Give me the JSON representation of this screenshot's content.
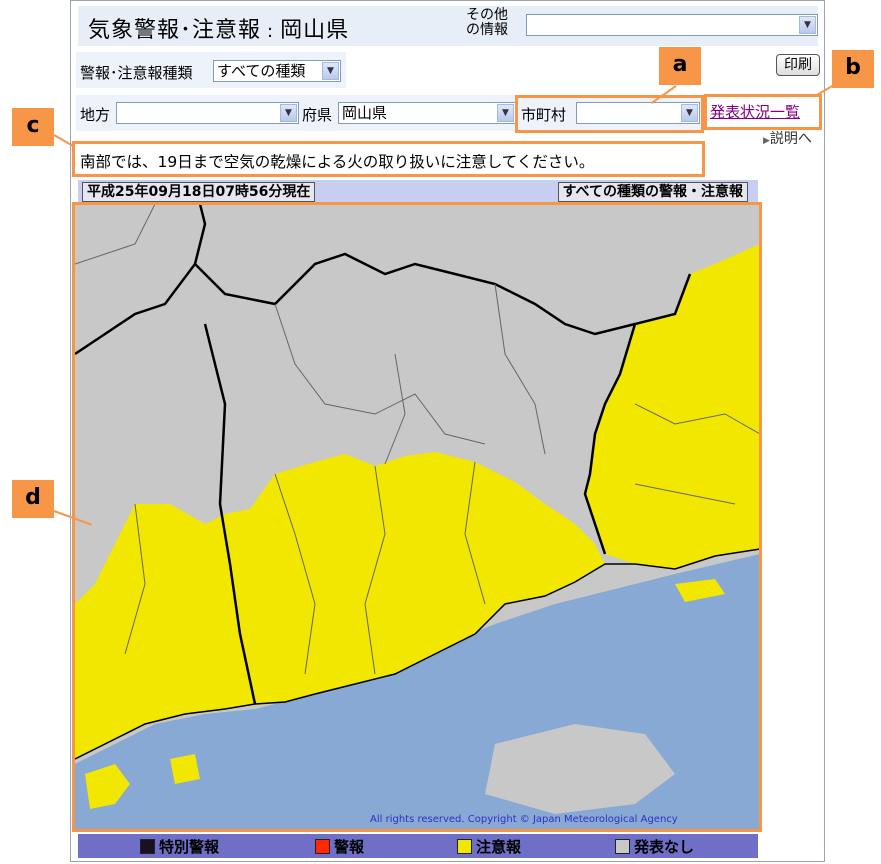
{
  "header": {
    "title": "気象警報･注意報",
    "region_label": "岡山県",
    "title_separator": ":"
  },
  "other_info": {
    "label_line1": "その他",
    "label_line2": "の情報",
    "value": ""
  },
  "filters": {
    "type_label": "警報･注意報種類",
    "type_value": "すべての種類",
    "region_label": "地方",
    "region_value": "",
    "prefecture_label": "府県",
    "prefecture_value": "岡山県",
    "city_label": "市町村",
    "city_value": ""
  },
  "toolbar": {
    "print_label": "印刷",
    "status_list_link": "発表状況一覧",
    "explanation_link": "説明へ"
  },
  "message": "南部では、19日まで空気の乾燥による火の取り扱いに注意してください。",
  "map_header": {
    "timestamp": "平成25年09月18日07時56分現在",
    "type_caption": "すべての種類の警報・注意報"
  },
  "copyright": "All rights reserved. Copyright © Japan Meteorological Agency",
  "legend": [
    {
      "label": "特別警報",
      "color": "#1a1020"
    },
    {
      "label": "警報",
      "color": "#ff2800"
    },
    {
      "label": "注意報",
      "color": "#f2e700"
    },
    {
      "label": "発表なし",
      "color": "#c8c8c8"
    }
  ],
  "callouts": {
    "a": "a",
    "b": "b",
    "c": "c",
    "d": "d"
  },
  "colors": {
    "advisory_yellow": "#f2e700",
    "no_alert_gray": "#c8c8c8",
    "sea_blue": "#87a9d4",
    "annotation_orange": "#f79646"
  }
}
